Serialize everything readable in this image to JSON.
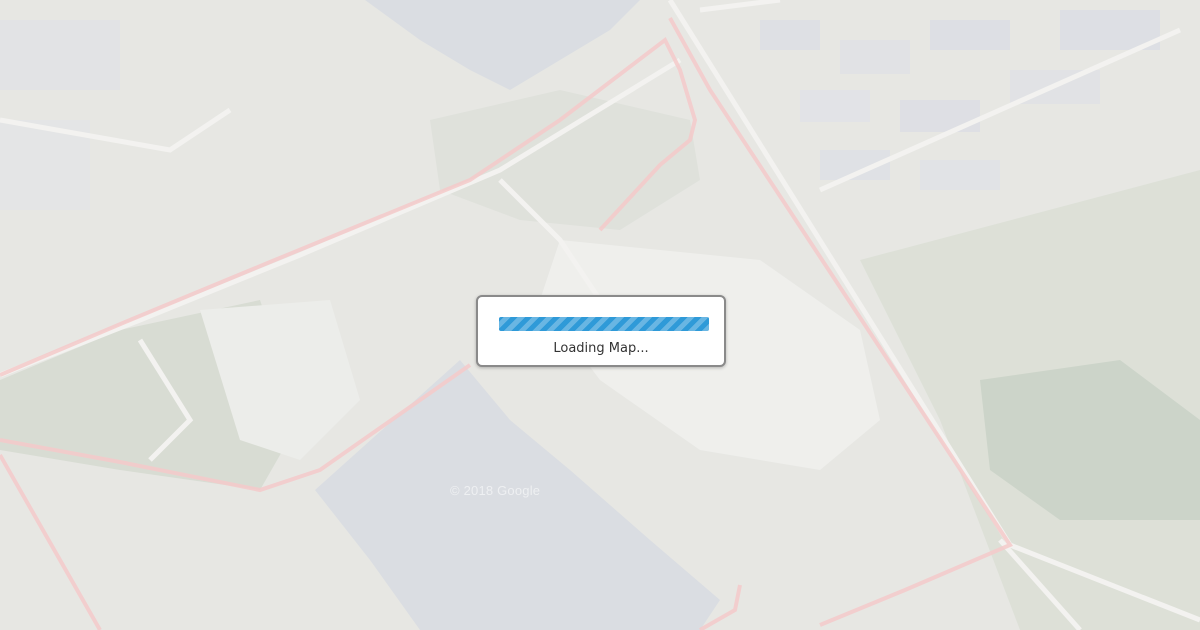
{
  "map": {
    "watermark": "© 2018 Google",
    "boundary_color": "#e88a8a",
    "water_color": "#aeb3bf"
  },
  "loading": {
    "label": "Loading Map...",
    "progress_percent": 100,
    "bar_color": "#2f9ad8"
  }
}
